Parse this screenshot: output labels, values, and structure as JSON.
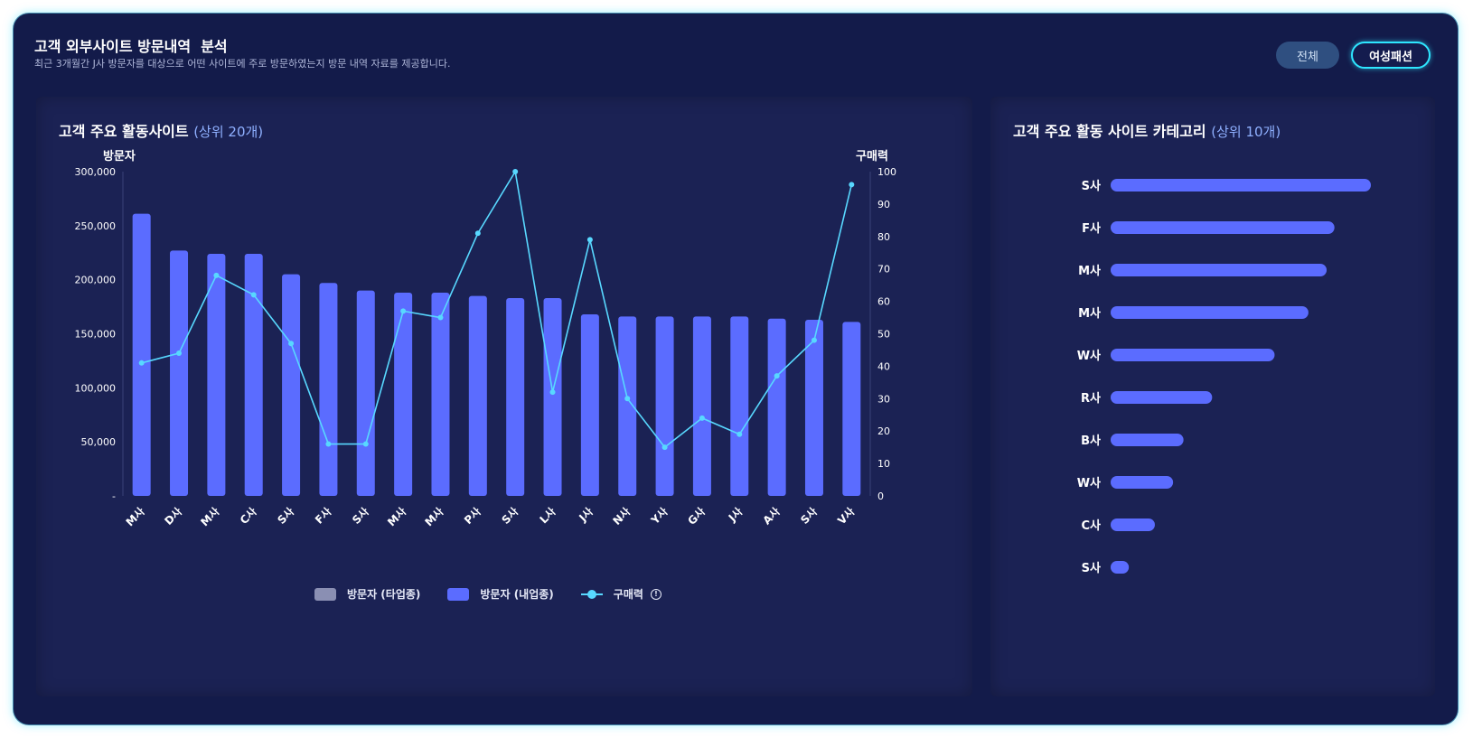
{
  "header": {
    "title": "고객 외부사이트 방문내역  분석",
    "subtitle": "최근 3개월간 J사 방문자를 대상으로 어떤 사이트에 주로 방문하였는지 방문 내역 자료를 제공합니다.",
    "buttons": {
      "all": "전체",
      "fashion": "여성패션"
    }
  },
  "left_panel": {
    "title": "고객 주요 활동사이트",
    "title_sub": "(상위 20개)"
  },
  "right_panel": {
    "title": "고객 주요 활동 사이트 카테고리",
    "title_sub": "(상위 10개)"
  },
  "colors": {
    "bar": "#5b6cff",
    "line": "#58d8ff",
    "other_industry": "#8a8fb3"
  },
  "chart_data": [
    {
      "type": "bar",
      "name_left_axis": "방문자",
      "name_right_axis": "구매력",
      "categories": [
        "M사",
        "D사",
        "M사",
        "C사",
        "S사",
        "F사",
        "S사",
        "M사",
        "M사",
        "P사",
        "S사",
        "L사",
        "J사",
        "N사",
        "Y사",
        "G사",
        "J사",
        "A사",
        "S사",
        "V사"
      ],
      "series": [
        {
          "name": "방문자 (타업종)",
          "type": "bar",
          "values": [
            0,
            0,
            0,
            0,
            0,
            0,
            0,
            0,
            0,
            0,
            0,
            0,
            0,
            0,
            0,
            0,
            0,
            0,
            0,
            0
          ]
        },
        {
          "name": "방문자 (내업종)",
          "type": "bar",
          "values": [
            261000,
            227000,
            224000,
            224000,
            205000,
            197000,
            190000,
            188000,
            188000,
            185000,
            183000,
            183000,
            168000,
            166000,
            166000,
            166000,
            166000,
            164000,
            163000,
            161000
          ]
        },
        {
          "name": "구매력",
          "type": "line",
          "axis": "right",
          "values": [
            41,
            44,
            68,
            62,
            47,
            16,
            16,
            57,
            55,
            81,
            100,
            32,
            79,
            30,
            15,
            24,
            19,
            37,
            48,
            96
          ]
        }
      ],
      "ylim": [
        0,
        300000
      ],
      "y_ticks": [
        "-",
        "50,000",
        "100,000",
        "150,000",
        "200,000",
        "250,000",
        "300,000"
      ],
      "y2lim": [
        0,
        100
      ],
      "y2_ticks": [
        "0",
        "10",
        "20",
        "30",
        "40",
        "50",
        "60",
        "70",
        "80",
        "90",
        "100"
      ],
      "legend": [
        "방문자 (타업종)",
        "방문자 (내업종)",
        "구매력"
      ],
      "legend_position": "bottom"
    },
    {
      "type": "bar",
      "orientation": "horizontal",
      "categories": [
        "S사",
        "F사",
        "M사",
        "M사",
        "W사",
        "R사",
        "B사",
        "W사",
        "C사",
        "S사"
      ],
      "values": [
        100,
        86,
        83,
        76,
        63,
        39,
        28,
        24,
        17,
        7
      ]
    }
  ]
}
